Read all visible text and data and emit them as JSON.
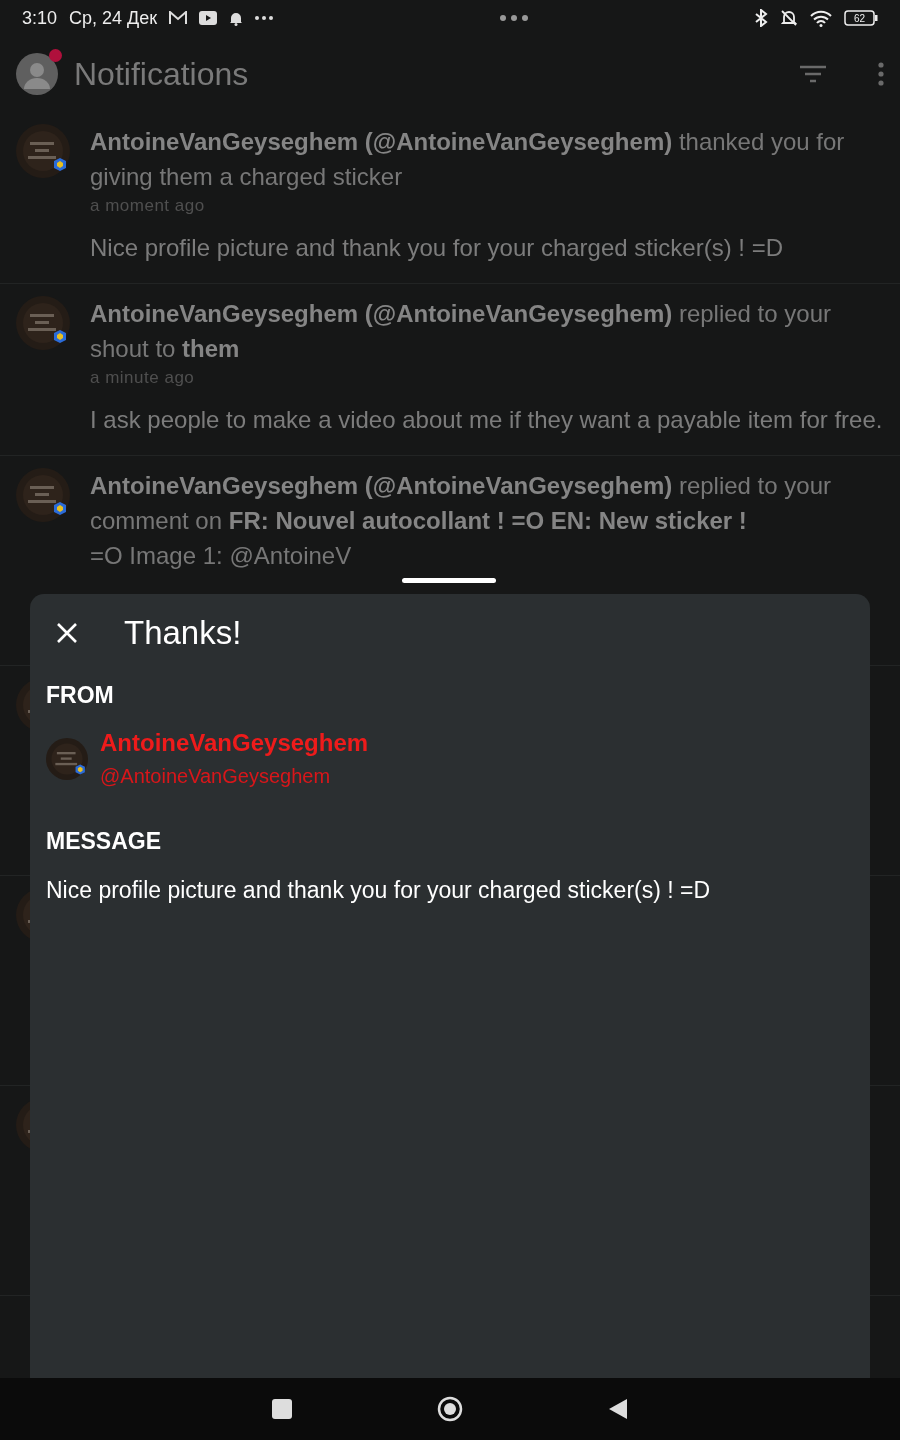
{
  "status_bar": {
    "time": "3:10",
    "date": "Ср, 24 Дек",
    "battery": "62"
  },
  "header": {
    "title": "Notifications",
    "unread_dot": true
  },
  "notifications": [
    {
      "kind": "full",
      "text": "**AntoineVanGeyseghem (@AntoineVanGeyseghem)** thanked you for giving them a charged sticker",
      "time": "a moment ago",
      "message": "Nice profile picture and thank you for your charged sticker(s) ! =D"
    },
    {
      "kind": "full",
      "text": "**AntoineVanGeyseghem (@AntoineVanGeyseghem)** replied to your shout to **them**",
      "time": "a minute ago",
      "message": "I ask people to make a video about me if they want a payable item for free."
    },
    {
      "kind": "full",
      "text": "**AntoineVanGeyseghem (@AntoineVanGeyseghem)** replied to your comment on **FR: Nouvel autocollant ! =O EN: New sticker !**",
      "overflow": "=O Image 1: @AntoineV"
    },
    {
      "kind": "covered"
    },
    {
      "kind": "covered"
    },
    {
      "kind": "covered"
    }
  ],
  "sheet": {
    "title": "Thanks!",
    "from_label": "FROM",
    "sender_name": "AntoineVanGeyseghem",
    "sender_handle": "@AntoineVanGeyseghem",
    "message_label": "MESSAGE",
    "message": "Nice profile picture and thank you for your charged sticker(s) ! =D"
  }
}
